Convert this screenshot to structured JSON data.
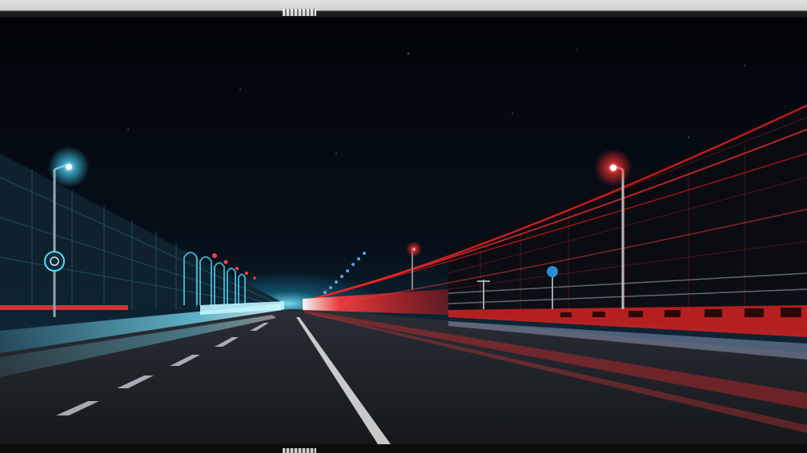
{
  "scene": {
    "subject": "night-highway-light-trails",
    "colors": {
      "sky_top": "#02040a",
      "sky_horizon": "#0f2a3a",
      "cyan_trail": "#39d8ff",
      "red_trail": "#ff2a2a",
      "road": "#1c1f24",
      "lamp_cyan": "#cfefff",
      "lamp_red": "#ffd0d0"
    },
    "icons": [
      "street-lamp-icon",
      "road-sign-icon"
    ]
  }
}
